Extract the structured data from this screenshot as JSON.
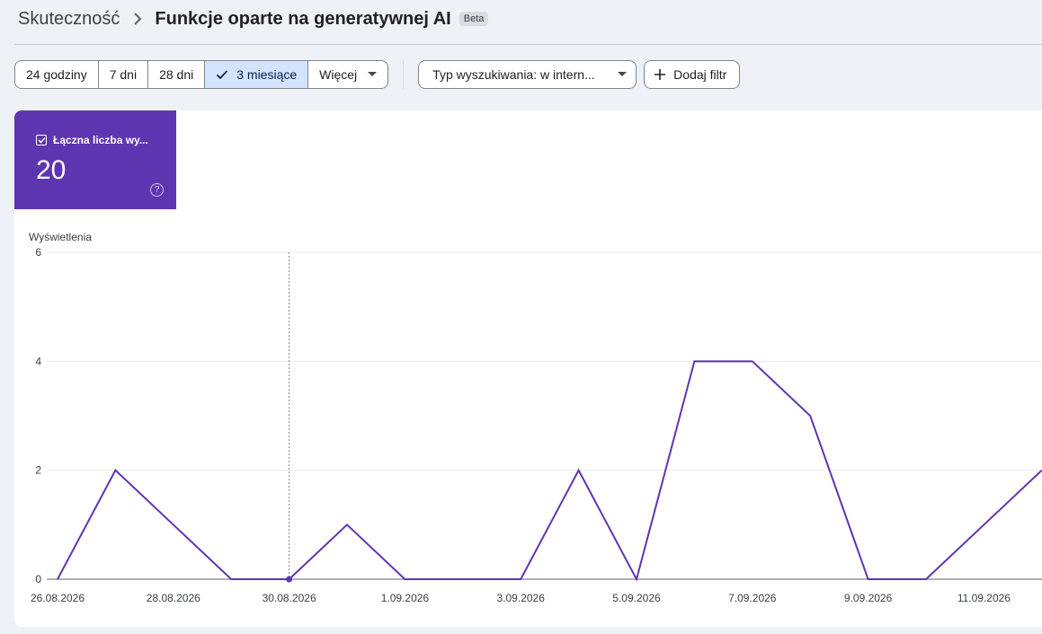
{
  "breadcrumb": {
    "parent": "Skuteczność",
    "current": "Funkcje oparte na generatywnej AI",
    "badge": "Beta"
  },
  "date_ranges": [
    {
      "label": "24 godziny",
      "selected": false
    },
    {
      "label": "7 dni",
      "selected": false
    },
    {
      "label": "28 dni",
      "selected": false
    },
    {
      "label": "3 miesiące",
      "selected": true
    },
    {
      "label": "Więcej",
      "selected": false
    }
  ],
  "filters": {
    "search_type": "Typ wyszukiwania: w intern...",
    "add_filter": "Dodaj filtr"
  },
  "metric": {
    "label": "Łączna liczba wy...",
    "value": "20",
    "checked": true,
    "color": "#5e35b1"
  },
  "chart_data": {
    "type": "line",
    "ylabel": "Wyświetlenia",
    "ylim": [
      0,
      6
    ],
    "yticks": [
      "0",
      "2",
      "4",
      "6"
    ],
    "xtick_labels": [
      "26.08.2026",
      "28.08.2026",
      "30.08.2026",
      "1.09.2026",
      "3.09.2026",
      "5.09.2026",
      "7.09.2026",
      "9.09.2026",
      "11.09.2026"
    ],
    "x": [
      "26.08.2026",
      "27.08.2026",
      "28.08.2026",
      "29.08.2026",
      "30.08.2026",
      "31.08.2026",
      "1.09.2026",
      "2.09.2026",
      "3.09.2026",
      "4.09.2026",
      "5.09.2026",
      "6.09.2026",
      "7.09.2026",
      "8.09.2026",
      "9.09.2026",
      "10.09.2026",
      "11.09.2026",
      "12.09.2026"
    ],
    "series": [
      {
        "color": "#5e35b1",
        "values": [
          0,
          2,
          1,
          0,
          0,
          1,
          0,
          0,
          0,
          2,
          0,
          4,
          4,
          3,
          0,
          0,
          1,
          2
        ]
      }
    ],
    "highlight": "30.08.2026",
    "grid": true
  }
}
